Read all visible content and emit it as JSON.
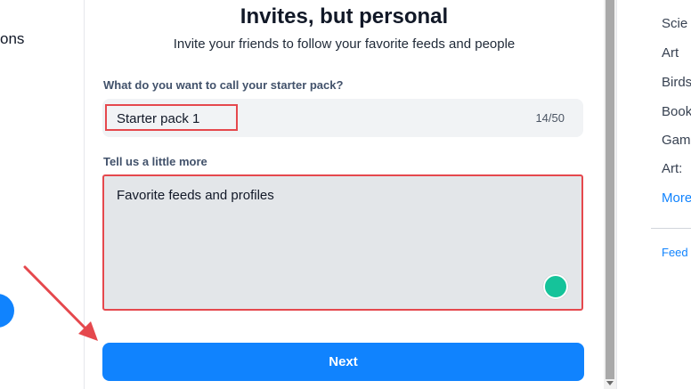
{
  "left_nav": {
    "partial_text": "ons"
  },
  "dialog": {
    "title": "Invites, but personal",
    "subtitle": "Invite your friends to follow your favorite feeds and people",
    "name_label": "What do you want to call your starter pack?",
    "name_value": "Starter pack 1",
    "name_counter": "14/50",
    "description_label": "Tell us a little more",
    "description_value": "Favorite feeds and profiles",
    "next_label": "Next"
  },
  "right_sidebar": {
    "items": [
      "Scie",
      "Art",
      "Birds",
      "Book",
      "Gam",
      "Art:"
    ],
    "more_label": "More",
    "feed_label": "Feed"
  },
  "colors": {
    "accent": "#1083fe",
    "annotation": "#e5484d",
    "grammarly": "#15c39a"
  },
  "icons": {
    "grammarly": "grammarly-icon",
    "annotation_arrow": "arrow-icon"
  }
}
